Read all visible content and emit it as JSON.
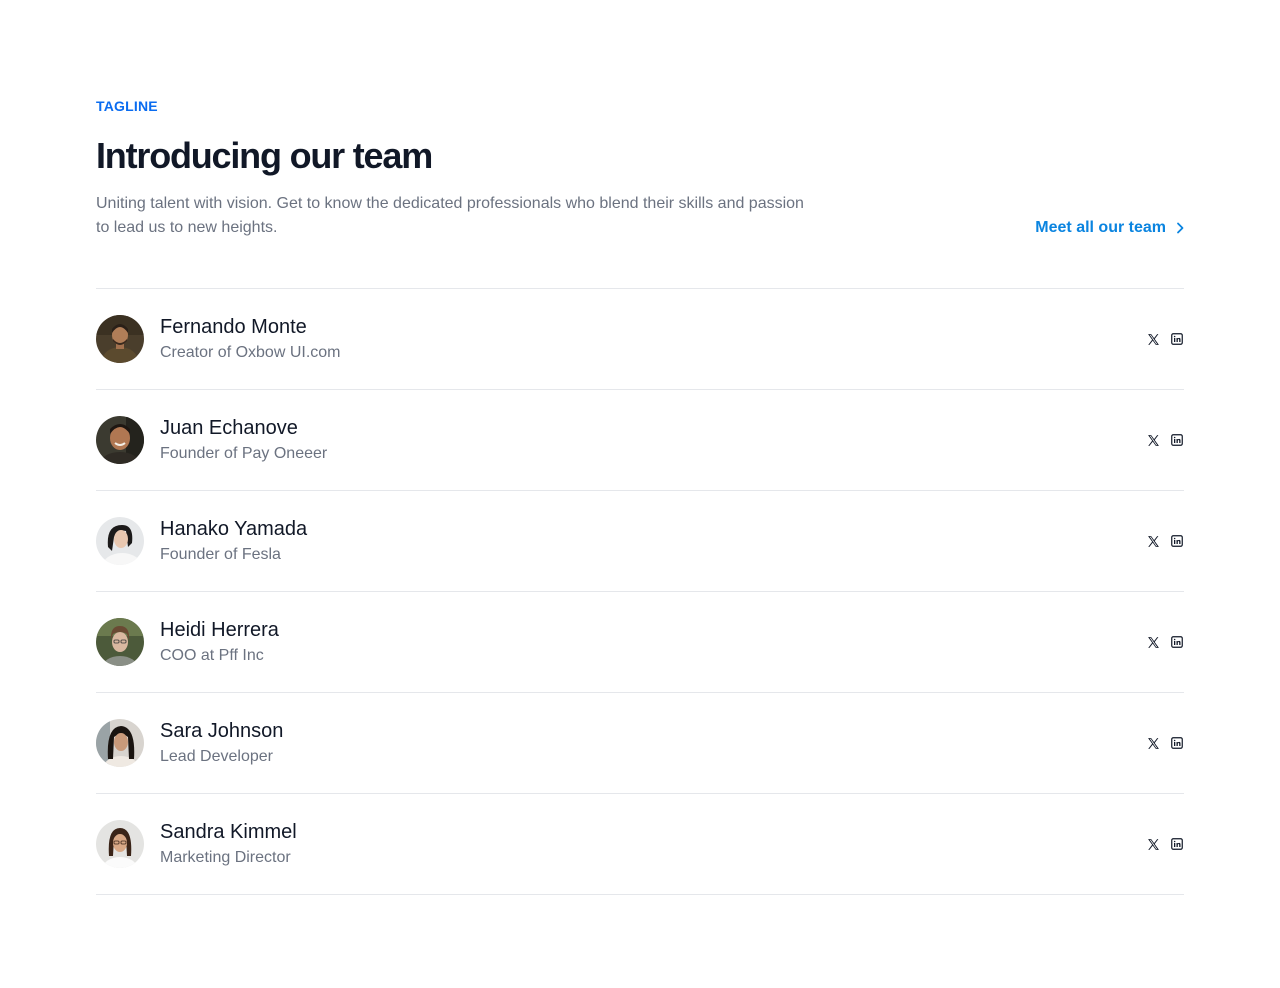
{
  "header": {
    "tagline": "TAGLINE",
    "title": "Introducing our team",
    "description": "Uniting talent with vision. Get to know the dedicated professionals who blend their skills and passion to lead us to new heights.",
    "cta_label": "Meet all our team"
  },
  "colors": {
    "accent": "#0a6cf0",
    "link": "#0a84e0",
    "heading": "#111827",
    "muted": "#6b7280",
    "divider": "#e5e7eb"
  },
  "team": [
    {
      "name": "Fernando Monte",
      "role": "Creator of Oxbow UI.com",
      "avatar_icon": "avatar-photo",
      "socials": [
        "x-icon",
        "linkedin-icon"
      ]
    },
    {
      "name": "Juan Echanove",
      "role": "Founder of Pay Oneeer",
      "avatar_icon": "avatar-photo",
      "socials": [
        "x-icon",
        "linkedin-icon"
      ]
    },
    {
      "name": "Hanako Yamada",
      "role": "Founder of Fesla",
      "avatar_icon": "avatar-photo",
      "socials": [
        "x-icon",
        "linkedin-icon"
      ]
    },
    {
      "name": "Heidi Herrera",
      "role": "COO at Pff Inc",
      "avatar_icon": "avatar-photo",
      "socials": [
        "x-icon",
        "linkedin-icon"
      ]
    },
    {
      "name": "Sara Johnson",
      "role": "Lead Developer",
      "avatar_icon": "avatar-photo",
      "socials": [
        "x-icon",
        "linkedin-icon"
      ]
    },
    {
      "name": "Sandra Kimmel",
      "role": "Marketing Director",
      "avatar_icon": "avatar-photo",
      "socials": [
        "x-icon",
        "linkedin-icon"
      ]
    }
  ]
}
